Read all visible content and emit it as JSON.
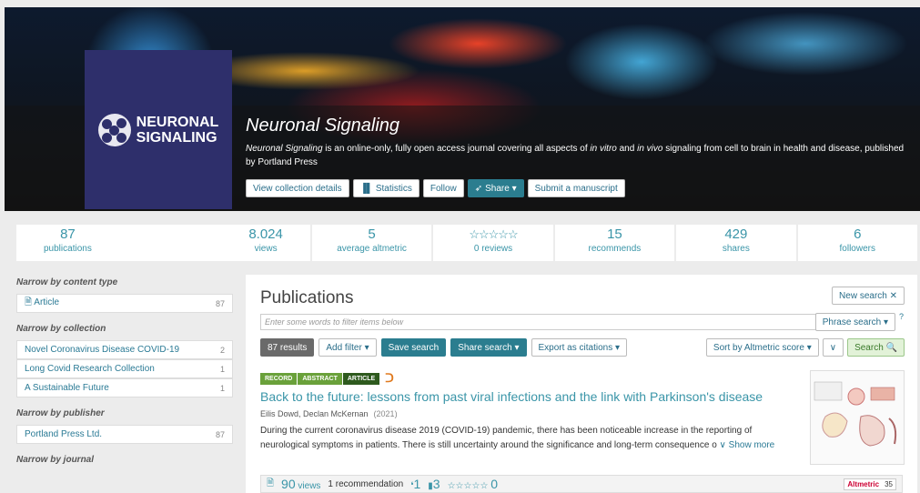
{
  "hero": {
    "logo_line1": "NEURONAL",
    "logo_line2": "SIGNALING",
    "title": "Neuronal Signaling",
    "desc_journal": "Neuronal Signaling",
    "desc_part1": " is an online-only, fully open access journal covering all aspects of ",
    "desc_invitro": "in vitro",
    "desc_and": " and ",
    "desc_invivo": "in vivo",
    "desc_part2": " signaling from cell to brain in health and disease, published by Portland Press",
    "buttons": {
      "details": "View collection details",
      "statistics": "Statistics",
      "follow": "Follow",
      "share": "Share ▾",
      "submit": "Submit a manuscript"
    }
  },
  "stats": {
    "publications_num": "87",
    "publications_lab": "publications",
    "views_num": "8.024",
    "views_lab": "views",
    "altmetric_num": "5",
    "altmetric_lab": "average altmetric",
    "reviews_stars": "☆☆☆☆☆",
    "reviews_lab": "0 reviews",
    "recommends_num": "15",
    "recommends_lab": "recommends",
    "shares_num": "429",
    "shares_lab": "shares",
    "followers_num": "6",
    "followers_lab": "followers"
  },
  "sidebar": {
    "content_type_h": "Narrow by content type",
    "content_type": [
      {
        "label": "Article",
        "count": "87"
      }
    ],
    "collection_h": "Narrow by collection",
    "collections": [
      {
        "label": "Novel Coronavirus Disease COVID-19",
        "count": "2"
      },
      {
        "label": "Long Covid Research Collection",
        "count": "1"
      },
      {
        "label": "A Sustainable Future",
        "count": "1"
      }
    ],
    "publisher_h": "Narrow by publisher",
    "publishers": [
      {
        "label": "Portland Press Ltd.",
        "count": "87"
      }
    ],
    "journal_h": "Narrow by journal"
  },
  "main": {
    "title": "Publications",
    "new_search": "New search ✕",
    "filter_placeholder": "Enter some words to filter items below",
    "phrase_search": "Phrase search ▾",
    "qmark": "?",
    "results": "87 results",
    "add_filter": "Add filter ▾",
    "save_search": "Save search",
    "share_search": "Share search ▾",
    "export": "Export as citations ▾",
    "sort": "Sort by Altmetric score ▾",
    "sort_dir": "∨",
    "search": "Search 🔍"
  },
  "article": {
    "badges": [
      "RECORD",
      "ABSTRACT",
      "ARTICLE"
    ],
    "oa_icon": "open-access-icon",
    "title": "Back to the future: lessons from past viral infections and the link with Parkinson's disease",
    "authors": "Eilis Dowd, Declan McKernan",
    "year": "(2021)",
    "abstract": "During the current coronavirus disease 2019 (COVID-19) pandemic, there has been noticeable increase in the reporting of neurological symptoms in patients. There is still uncertainty around the significance and long-term consequence o",
    "show_more": "∨ Show more",
    "views_num": "90",
    "views_lab": "views",
    "recommendation": "1 recommendation",
    "cites": "1",
    "docs": "3",
    "stars": "☆☆☆☆☆",
    "reviews": "0",
    "altmetric_label": "Altmetric",
    "altmetric_score": "35"
  }
}
